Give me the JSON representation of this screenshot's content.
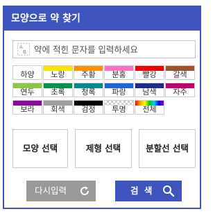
{
  "header": {
    "title": "모양으로 약 찾기"
  },
  "search": {
    "placeholder": "약에 적힌 문자를 입력하세요",
    "value": ""
  },
  "colors": [
    {
      "label": "하양",
      "color": "#ffffff"
    },
    {
      "label": "노랑",
      "color": "#ffe400"
    },
    {
      "label": "주황",
      "color": "#ff9000"
    },
    {
      "label": "분홍",
      "color": "#ff70c6"
    },
    {
      "label": "빨강",
      "color": "#ee0000"
    },
    {
      "label": "갈색",
      "color": "#a0522d"
    },
    {
      "label": "연두",
      "color": "#8dc63f"
    },
    {
      "label": "초록",
      "color": "#00944a"
    },
    {
      "label": "청록",
      "color": "#008c8c"
    },
    {
      "label": "파랑",
      "color": "#1f64d8"
    },
    {
      "label": "남색",
      "color": "#1e2a8c"
    },
    {
      "label": "자주",
      "color": "#c0006e"
    },
    {
      "label": "보라",
      "color": "#8a0aa0"
    },
    {
      "label": "회색",
      "color": "#9e9e9e"
    },
    {
      "label": "검정",
      "color": "#000000"
    },
    {
      "label": "투명",
      "color": "checker"
    },
    {
      "label": "전체",
      "color": "rainbow"
    }
  ],
  "selectors": {
    "shape_label": "모양 선택",
    "form_label": "제형 선택",
    "split_label": "분할선 선택"
  },
  "actions": {
    "reset_label": "다시입력",
    "search_label": "검 색"
  },
  "theme": {
    "accent": "#3f55bd",
    "reset_bg": "#999999"
  }
}
